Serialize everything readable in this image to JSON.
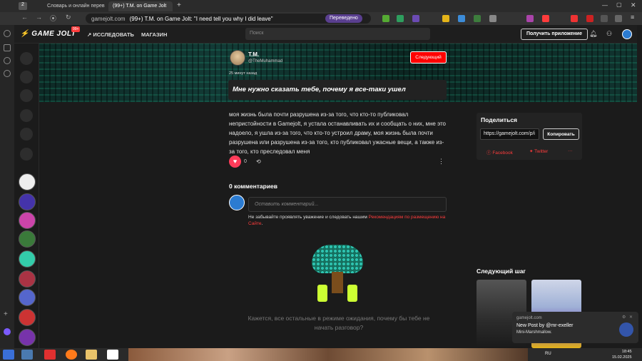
{
  "browser": {
    "tabs": [
      {
        "label": "Словарь и онлайн перев",
        "active": false
      },
      {
        "label": "(99+) T.M. on Game Jolt",
        "active": true
      }
    ],
    "tab_count": "2",
    "url_domain": "gamejolt.com",
    "page_title": "(99+) T.M. on Game Jolt: \"I need tell you why I did leave\"",
    "translated_label": "Переведено"
  },
  "gj_nav": {
    "logo": "GAME JOLT",
    "badge": "99+",
    "explore": "ИССЛЕДОВАТЬ",
    "store": "МАГАЗИН",
    "search_placeholder": "Поиск",
    "get_app": "Получить приложение"
  },
  "post": {
    "author_name": "T.M.",
    "author_handle": "@TheMuhammad",
    "follow_label": "Следующий",
    "time_ago": "25 минут назад",
    "title": "Мне нужно сказать тебе, почему я все-таки ушел",
    "body": "моя жизнь была почти разрушена из-за того, что кто-то публиковал непристойности в Gamejolt, я устала останавливать их и сообщать о них, мне это надоело, я ушла из-за того, что кто-то устроил драму, моя жизнь была почти разрушена или разрушена из-за того, кто публиковал ужасные вещи, а также из-за того, кто преследовал меня",
    "like_count": "0"
  },
  "comments": {
    "heading": "0 комментариев",
    "placeholder": "Оставить комментарий...",
    "note_prefix": "Не забывайте проявлять уважение и следовать нашим ",
    "note_link": "Рекомендациям по размещению на Сайте",
    "note_suffix": ".",
    "empty_message": "Кажется, все остальные в режиме ожидания, почему бы тебе не начать разговор?"
  },
  "share": {
    "heading": "Поделиться",
    "url": "https://gamejolt.com/p/i",
    "copy_label": "Копировать",
    "facebook": "Facebook",
    "twitter": "Twitter",
    "more": "···"
  },
  "next_step": {
    "heading": "Следующий шаг"
  },
  "notification": {
    "source": "gamejolt.com",
    "title": "New Post by @mr-exeller",
    "body": "Mini-Marshmallow."
  },
  "taskbar": {
    "lang": "RU",
    "time": "18:45",
    "date": "15.02.2025"
  }
}
